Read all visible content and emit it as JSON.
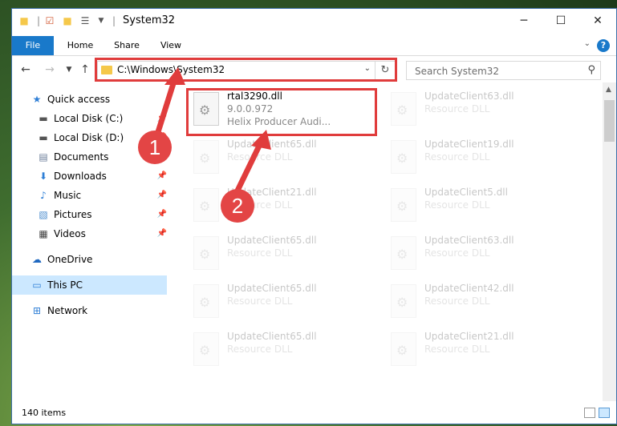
{
  "window": {
    "title": "System32"
  },
  "ribbon": {
    "tabs": [
      "File",
      "Home",
      "Share",
      "View"
    ],
    "help": "?"
  },
  "navbar": {
    "address": "C:\\Windows\\System32",
    "search_placeholder": "Search System32"
  },
  "sidebar": {
    "items": [
      {
        "label": "Quick access",
        "icon": "star-icon",
        "pinned": false
      },
      {
        "label": "Local Disk (C:)",
        "icon": "drive-icon",
        "pinned": true
      },
      {
        "label": "Local Disk (D:)",
        "icon": "drive-icon",
        "pinned": true
      },
      {
        "label": "Documents",
        "icon": "documents-icon",
        "pinned": true
      },
      {
        "label": "Downloads",
        "icon": "download-icon",
        "pinned": true
      },
      {
        "label": "Music",
        "icon": "music-icon",
        "pinned": true
      },
      {
        "label": "Pictures",
        "icon": "pictures-icon",
        "pinned": true
      },
      {
        "label": "Videos",
        "icon": "videos-icon",
        "pinned": true
      },
      {
        "label": "OneDrive",
        "icon": "cloud-icon",
        "pinned": false
      },
      {
        "label": "This PC",
        "icon": "computer-icon",
        "pinned": false
      },
      {
        "label": "Network",
        "icon": "network-icon",
        "pinned": false
      }
    ]
  },
  "files": [
    {
      "name": "rtal3290.dll",
      "line2": "9.0.0.972",
      "line3": "Helix Producer Audi...",
      "highlighted": true
    },
    {
      "name": "UpdateClient63.dll",
      "line2": "Resource DLL"
    },
    {
      "name": "UpdateClient65.dll",
      "line2": "Resource DLL"
    },
    {
      "name": "UpdateClient19.dll",
      "line2": "Resource DLL"
    },
    {
      "name": "UpdateClient21.dll",
      "line2": "Resource DLL"
    },
    {
      "name": "UpdateClient5.dll",
      "line2": "Resource DLL"
    },
    {
      "name": "UpdateClient65.dll",
      "line2": "Resource DLL"
    },
    {
      "name": "UpdateClient63.dll",
      "line2": "Resource DLL"
    },
    {
      "name": "UpdateClient65.dll",
      "line2": "Resource DLL"
    },
    {
      "name": "UpdateClient42.dll",
      "line2": "Resource DLL"
    },
    {
      "name": "UpdateClient65.dll",
      "line2": "Resource DLL"
    },
    {
      "name": "UpdateClient21.dll",
      "line2": "Resource DLL"
    }
  ],
  "status": {
    "items": "140 items"
  },
  "annotations": {
    "step1": "1",
    "step2": "2"
  },
  "colors": {
    "accent": "#1979ca",
    "annotation": "#e03c3c",
    "selected": "#cce8ff"
  }
}
